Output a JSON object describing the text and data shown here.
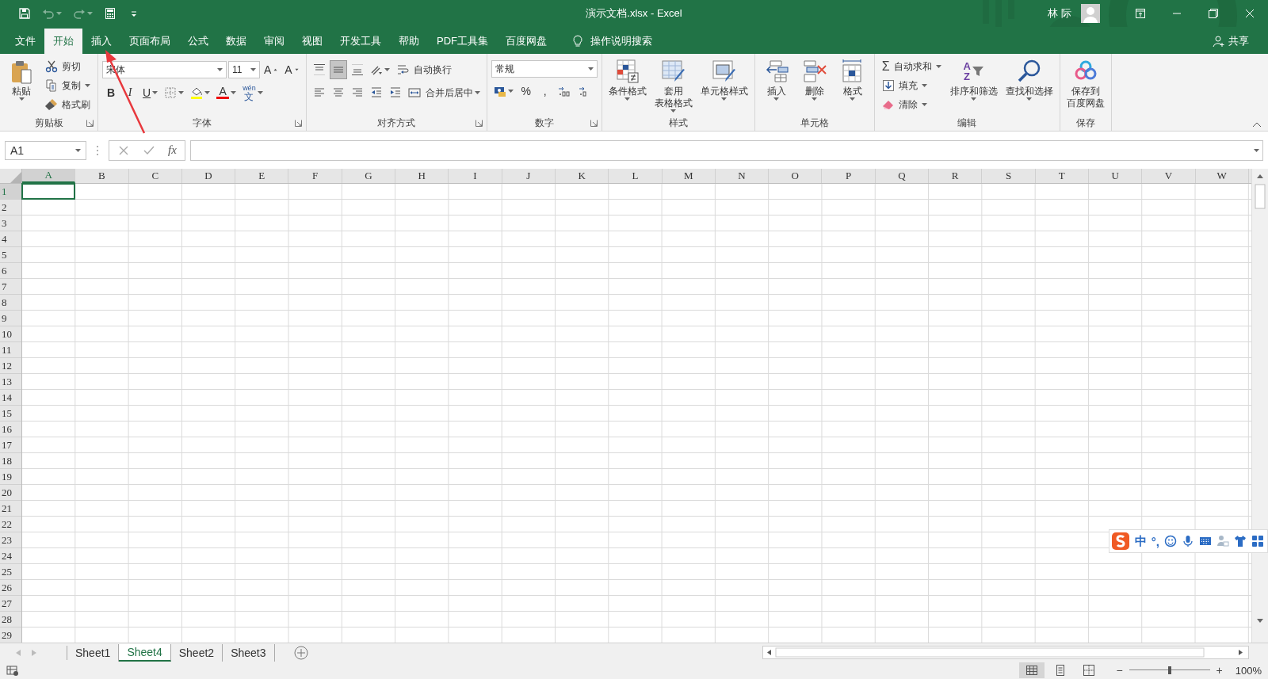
{
  "window": {
    "title": "演示文档.xlsx - Excel",
    "user": "林 际"
  },
  "quick_access": [
    {
      "kind": "save",
      "disabled": false,
      "dropdown": false
    },
    {
      "kind": "undo",
      "disabled": true,
      "dropdown": true
    },
    {
      "kind": "redo",
      "disabled": true,
      "dropdown": true
    },
    {
      "kind": "form",
      "disabled": false,
      "dropdown": false
    },
    {
      "kind": "customize",
      "disabled": false,
      "dropdown": false
    }
  ],
  "tabs": [
    {
      "label": "文件",
      "selected": false
    },
    {
      "label": "开始",
      "selected": true
    },
    {
      "label": "插入",
      "selected": false
    },
    {
      "label": "页面布局",
      "selected": false
    },
    {
      "label": "公式",
      "selected": false
    },
    {
      "label": "数据",
      "selected": false
    },
    {
      "label": "审阅",
      "selected": false
    },
    {
      "label": "视图",
      "selected": false
    },
    {
      "label": "开发工具",
      "selected": false
    },
    {
      "label": "帮助",
      "selected": false
    },
    {
      "label": "PDF工具集",
      "selected": false
    },
    {
      "label": "百度网盘",
      "selected": false
    }
  ],
  "tell_me": "操作说明搜索",
  "share": "共享",
  "ribbon": [
    {
      "label": "剪贴板",
      "launcher": true,
      "blocks": [
        {
          "kind": "paste",
          "lines": [
            "粘贴"
          ],
          "dropdown": true
        },
        {
          "kind": "stack",
          "items": [
            {
              "kind": "cut",
              "label": "剪切",
              "dropdown": false
            },
            {
              "kind": "copy",
              "label": "复制",
              "dropdown": true
            },
            {
              "kind": "brush",
              "label": "格式刷",
              "dropdown": false
            }
          ]
        }
      ]
    },
    {
      "label": "字体",
      "launcher": true,
      "blocks": [
        {
          "kind": "rows",
          "rows": [
            [
              {
                "kind": "font",
                "value": "宋体"
              },
              {
                "kind": "size",
                "value": "11"
              },
              {
                "kind": "grow",
                "label": "A"
              },
              {
                "kind": "shrink",
                "label": "A"
              }
            ],
            [
              {
                "kind": "bold",
                "label": "B"
              },
              {
                "kind": "italic",
                "label": "I"
              },
              {
                "kind": "underline",
                "label": "U",
                "dropdown": true
              },
              {
                "kind": "borders",
                "dropdown": true
              },
              {
                "kind": "fill",
                "dropdown": true
              },
              {
                "kind": "font-color",
                "label": "A",
                "dropdown": true
              },
              {
                "kind": "phonetic",
                "ruby": "wén",
                "label": "文",
                "dropdown": true
              }
            ]
          ]
        }
      ]
    },
    {
      "label": "对齐方式",
      "launcher": true,
      "blocks": [
        {
          "kind": "rows",
          "rows": [
            [
              {
                "kind": "align-top",
                "selected": false
              },
              {
                "kind": "align-middle",
                "selected": true
              },
              {
                "kind": "align-bottom",
                "selected": false
              },
              {
                "kind": "orientation",
                "dropdown": true
              },
              {
                "kind": "wrap",
                "label": "自动换行"
              }
            ],
            [
              {
                "kind": "align-left",
                "selected": false
              },
              {
                "kind": "align-center",
                "selected": false
              },
              {
                "kind": "align-right",
                "selected": false
              },
              {
                "kind": "indent-less"
              },
              {
                "kind": "indent-more"
              },
              {
                "kind": "merge",
                "label": "合并后居中",
                "dropdown": true
              }
            ]
          ]
        }
      ]
    },
    {
      "label": "数字",
      "launcher": true,
      "blocks": [
        {
          "kind": "rows",
          "rows": [
            [
              {
                "kind": "number-format",
                "value": "常规"
              }
            ],
            [
              {
                "kind": "currency",
                "dropdown": true
              },
              {
                "kind": "percent",
                "label": "%"
              },
              {
                "kind": "comma",
                "label": ","
              },
              {
                "kind": "decimal-more"
              },
              {
                "kind": "decimal-less"
              }
            ]
          ]
        }
      ]
    },
    {
      "label": "样式",
      "launcher": false,
      "blocks": [
        {
          "kind": "conditional-format",
          "lines": [
            "条件格式"
          ],
          "dropdown": true
        },
        {
          "kind": "table-format",
          "lines": [
            "套用",
            "表格格式"
          ],
          "dropdown": true
        },
        {
          "kind": "cell-style",
          "lines": [
            "单元格样式"
          ],
          "dropdown": true
        }
      ]
    },
    {
      "label": "单元格",
      "launcher": false,
      "blocks": [
        {
          "kind": "insert-cells",
          "lines": [
            "插入"
          ],
          "dropdown": true
        },
        {
          "kind": "delete-cells",
          "lines": [
            "删除"
          ],
          "dropdown": true
        },
        {
          "kind": "format-cells",
          "lines": [
            "格式"
          ],
          "dropdown": true
        }
      ]
    },
    {
      "label": "编辑",
      "launcher": false,
      "blocks": [
        {
          "kind": "stack",
          "items": [
            {
              "kind": "autosum",
              "glyph": "Σ",
              "label": "自动求和",
              "dropdown": true
            },
            {
              "kind": "fill-down",
              "label": "填充",
              "dropdown": true
            },
            {
              "kind": "clear",
              "label": "清除",
              "dropdown": true
            }
          ]
        },
        {
          "kind": "sort-filter",
          "glyphs": [
            "A",
            "Z"
          ],
          "lines": [
            "排序和筛选"
          ],
          "dropdown": true
        },
        {
          "kind": "find",
          "lines": [
            "查找和选择"
          ],
          "dropdown": true
        }
      ]
    },
    {
      "label": "保存",
      "launcher": false,
      "blocks": [
        {
          "kind": "baidu-save",
          "lines": [
            "保存到",
            "百度网盘"
          ],
          "dropdown": false
        }
      ]
    }
  ],
  "name_box": "A1",
  "function_label": "fx",
  "columns": [
    {
      "label": "A",
      "selected": true
    },
    {
      "label": "B",
      "selected": false
    },
    {
      "label": "C",
      "selected": false
    },
    {
      "label": "D",
      "selected": false
    },
    {
      "label": "E",
      "selected": false
    },
    {
      "label": "F",
      "selected": false
    },
    {
      "label": "G",
      "selected": false
    },
    {
      "label": "H",
      "selected": false
    },
    {
      "label": "I",
      "selected": false
    },
    {
      "label": "J",
      "selected": false
    },
    {
      "label": "K",
      "selected": false
    },
    {
      "label": "L",
      "selected": false
    },
    {
      "label": "M",
      "selected": false
    },
    {
      "label": "N",
      "selected": false
    },
    {
      "label": "O",
      "selected": false
    },
    {
      "label": "P",
      "selected": false
    },
    {
      "label": "Q",
      "selected": false
    },
    {
      "label": "R",
      "selected": false
    },
    {
      "label": "S",
      "selected": false
    },
    {
      "label": "T",
      "selected": false
    },
    {
      "label": "U",
      "selected": false
    },
    {
      "label": "V",
      "selected": false
    },
    {
      "label": "W",
      "selected": false
    }
  ],
  "rows": [
    {
      "label": "1",
      "selected": true
    },
    {
      "label": "2",
      "selected": false
    },
    {
      "label": "3",
      "selected": false
    },
    {
      "label": "4",
      "selected": false
    },
    {
      "label": "5",
      "selected": false
    },
    {
      "label": "6",
      "selected": false
    },
    {
      "label": "7",
      "selected": false
    },
    {
      "label": "8",
      "selected": false
    },
    {
      "label": "9",
      "selected": false
    },
    {
      "label": "10",
      "selected": false
    },
    {
      "label": "11",
      "selected": false
    },
    {
      "label": "12",
      "selected": false
    },
    {
      "label": "13",
      "selected": false
    },
    {
      "label": "14",
      "selected": false
    },
    {
      "label": "15",
      "selected": false
    },
    {
      "label": "16",
      "selected": false
    },
    {
      "label": "17",
      "selected": false
    },
    {
      "label": "18",
      "selected": false
    },
    {
      "label": "19",
      "selected": false
    },
    {
      "label": "20",
      "selected": false
    },
    {
      "label": "21",
      "selected": false
    },
    {
      "label": "22",
      "selected": false
    },
    {
      "label": "23",
      "selected": false
    },
    {
      "label": "24",
      "selected": false
    },
    {
      "label": "25",
      "selected": false
    },
    {
      "label": "26",
      "selected": false
    },
    {
      "label": "27",
      "selected": false
    },
    {
      "label": "28",
      "selected": false
    },
    {
      "label": "29",
      "selected": false
    }
  ],
  "sheets": [
    {
      "label": "Sheet1",
      "selected": false
    },
    {
      "label": "Sheet4",
      "selected": true
    },
    {
      "label": "Sheet2",
      "selected": false
    },
    {
      "label": "Sheet3",
      "selected": false
    }
  ],
  "status": {
    "views": [
      {
        "kind": "normal",
        "selected": true
      },
      {
        "kind": "page-layout",
        "selected": false
      },
      {
        "kind": "page-break",
        "selected": false
      }
    ],
    "zoom_out": "−",
    "zoom_in": "+",
    "level": 0.5,
    "zoom": "100%"
  },
  "ime": {
    "mode": "中",
    "punct": "°,"
  }
}
